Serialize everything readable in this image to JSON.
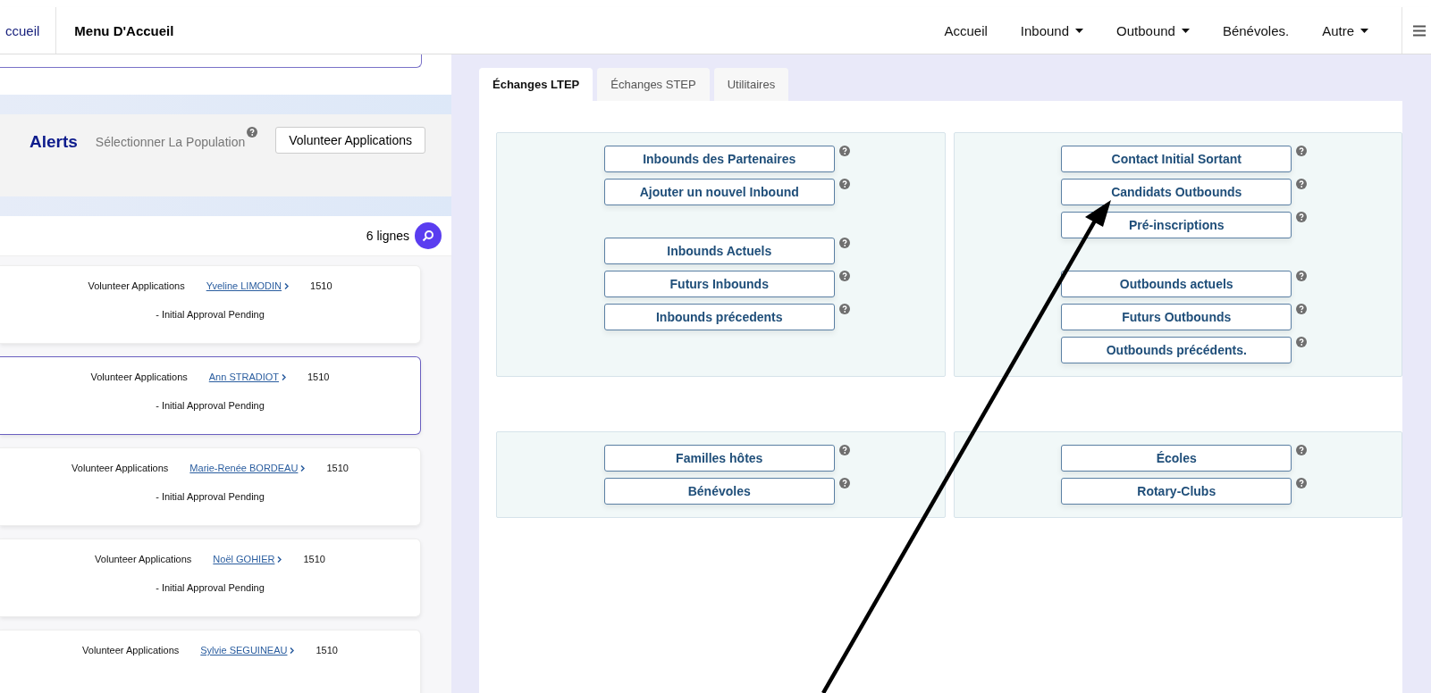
{
  "header": {
    "brand": "ccueil",
    "title": "Menu D'Accueil",
    "nav": [
      {
        "label": "Accueil",
        "kind": "link"
      },
      {
        "label": "Inbound",
        "kind": "dropdown"
      },
      {
        "label": "Outbound",
        "kind": "dropdown"
      },
      {
        "label": "Bénévoles.",
        "kind": "link"
      },
      {
        "label": "Autre",
        "kind": "dropdown"
      }
    ]
  },
  "alerts": {
    "title": "Alerts",
    "population_label": "Sélectionner La Population",
    "population_value": "Volunteer Applications"
  },
  "list": {
    "count": "6 lignes",
    "rows": [
      {
        "type": "Volunteer Applications",
        "name": "Yveline LIMODIN",
        "number": "1510",
        "status": "- Initial Approval Pending",
        "selected": false
      },
      {
        "type": "Volunteer Applications",
        "name": "Ann STRADIOT",
        "number": "1510",
        "status": "- Initial Approval Pending",
        "selected": true
      },
      {
        "type": "Volunteer Applications",
        "name": "Marie-Renée BORDEAU",
        "number": "1510",
        "status": "- Initial Approval Pending",
        "selected": false
      },
      {
        "type": "Volunteer Applications",
        "name": "Noël GOHIER",
        "number": "1510",
        "status": "- Initial Approval Pending",
        "selected": false
      },
      {
        "type": "Volunteer Applications",
        "name": "Sylvie SEGUINEAU",
        "number": "1510",
        "selected": false
      }
    ]
  },
  "tabs": [
    {
      "label": "Échanges LTEP",
      "selected": true
    },
    {
      "label": "Échanges STEP",
      "selected": false
    },
    {
      "label": "Utilitaires",
      "selected": false
    }
  ],
  "boxes": [
    {
      "groups": [
        [
          "Inbounds des Partenaires",
          "Ajouter un nouvel Inbound"
        ],
        [
          "Inbounds Actuels",
          "Futurs Inbounds",
          "Inbounds précedents"
        ]
      ]
    },
    {
      "groups": [
        [
          "Contact Initial Sortant",
          "Candidats Outbounds",
          "Pré-inscriptions"
        ],
        [
          "Outbounds actuels",
          "Futurs Outbounds",
          "Outbounds précédents."
        ]
      ]
    },
    {
      "groups": [
        [
          "Familles hôtes",
          "Bénévoles"
        ]
      ]
    },
    {
      "groups": [
        [
          "Écoles",
          "Rotary-Clubs"
        ]
      ]
    }
  ]
}
